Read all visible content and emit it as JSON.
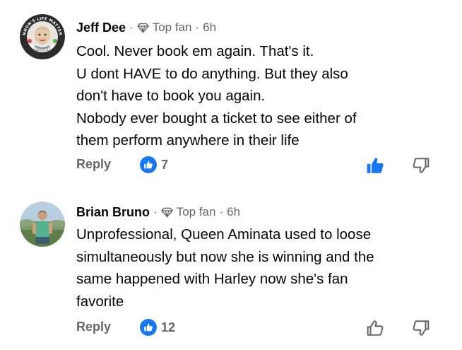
{
  "comments": [
    {
      "author": "Jeff Dee",
      "badge": "Top fan",
      "time": "6h",
      "lines": [
        "Cool. Never book em again. That's it.",
        "U dont HAVE to do anything. But they also",
        "don't have to book you again.",
        "Nobody ever bought a ticket to see either of",
        "them perform anywhere in their life"
      ],
      "reply_label": "Reply",
      "reaction_count": "7",
      "liked": true,
      "avatar_ring_text": "CANNON'S LIFE MATTERED",
      "avatar_bottom_text": "#SAYHISNAME"
    },
    {
      "author": "Brian Bruno",
      "badge": "Top fan",
      "time": "6h",
      "lines": [
        "Unprofessional, Queen Aminata used to loose",
        "simultaneously but now she is winning and the",
        "same happened with Harley now she's fan",
        "favorite"
      ],
      "reply_label": "Reply",
      "reaction_count": "12",
      "liked": false
    }
  ],
  "separator": "·",
  "colors": {
    "accent": "#1877f2",
    "secondary_text": "#65676b",
    "primary_text": "#050505"
  },
  "icons": {
    "badge": "top-fan-diamond-icon",
    "like": "thumbs-up-icon",
    "dislike": "thumbs-down-icon"
  }
}
